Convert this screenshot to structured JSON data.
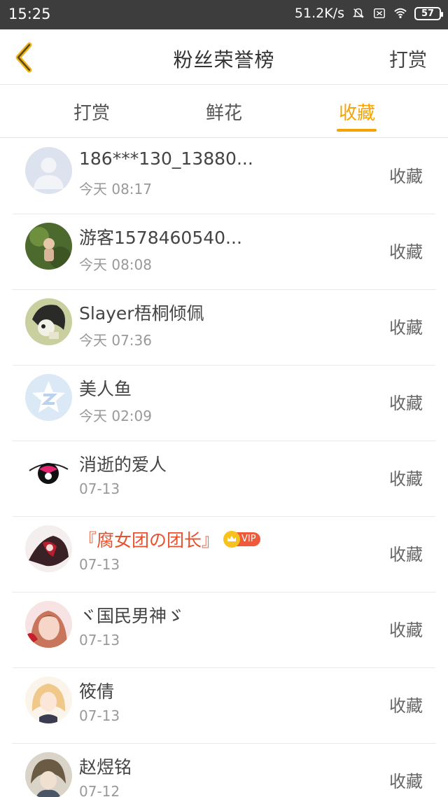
{
  "status_bar": {
    "time": "15:25",
    "network_speed": "51.2K/s",
    "battery": "57"
  },
  "nav": {
    "title": "粉丝荣誉榜",
    "right_action": "打赏"
  },
  "tabs": [
    {
      "label": "打赏",
      "active": false
    },
    {
      "label": "鲜花",
      "active": false
    },
    {
      "label": "收藏",
      "active": true
    }
  ],
  "list": [
    {
      "name": "186***130_13880...",
      "time": "今天 08:17",
      "action": "收藏"
    },
    {
      "name": "游客1578460540...",
      "time": "今天 08:08",
      "action": "收藏"
    },
    {
      "name": "Slayer梧桐倾佩",
      "time": "今天 07:36",
      "action": "收藏"
    },
    {
      "name": "美人鱼",
      "time": "今天 02:09",
      "action": "收藏"
    },
    {
      "name": "消逝的爱人",
      "time": "07-13",
      "action": "收藏"
    },
    {
      "name": "『腐女团の团长』",
      "time": "07-13",
      "action": "收藏",
      "vip": "VIP"
    },
    {
      "name": "ヾ国民男神ゞ",
      "time": "07-13",
      "action": "收藏"
    },
    {
      "name": "筱倩",
      "time": "07-13",
      "action": "收藏"
    },
    {
      "name": "赵煜铭",
      "time": "07-12",
      "action": "收藏"
    }
  ],
  "colors": {
    "accent": "#f5a300",
    "vip_name": "#e8512e",
    "status_bar_bg": "#3d3d3d"
  }
}
